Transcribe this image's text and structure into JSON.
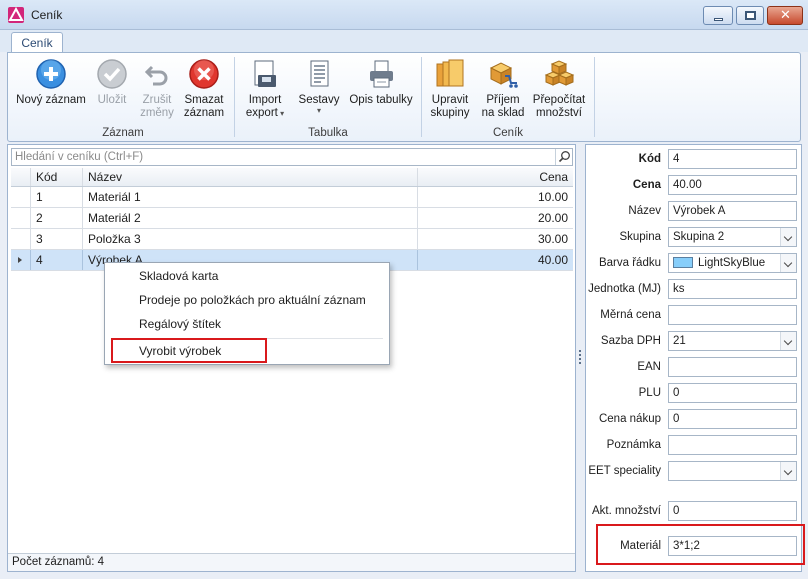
{
  "window": {
    "title": "Ceník"
  },
  "ribbon": {
    "tab": "Ceník",
    "groups": [
      {
        "label": "Záznam"
      },
      {
        "label": "Tabulka"
      },
      {
        "label": "Ceník"
      }
    ],
    "buttons": {
      "new": {
        "line1": "Nový záznam",
        "line2": ""
      },
      "save": {
        "line1": "Uložit",
        "line2": ""
      },
      "cancel": {
        "line1": "Zrušit",
        "line2": "změny"
      },
      "delete": {
        "line1": "Smazat",
        "line2": "záznam"
      },
      "import": {
        "line1": "Import",
        "line2": "export"
      },
      "reports": {
        "line1": "Sestavy",
        "line2": ""
      },
      "copy_table": {
        "line1": "Opis tabulky",
        "line2": ""
      },
      "edit_groups": {
        "line1": "Upravit",
        "line2": "skupiny"
      },
      "receive": {
        "line1": "Příjem",
        "line2": "na sklad"
      },
      "recalc": {
        "line1": "Přepočítat",
        "line2": "množství"
      }
    }
  },
  "search": {
    "placeholder": "Hledání v ceníku (Ctrl+F)"
  },
  "grid": {
    "columns": {
      "kod": "Kód",
      "nazev": "Název",
      "cena": "Cena"
    },
    "rows": [
      {
        "kod": "1",
        "nazev": "Materiál 1",
        "cena": "10.00"
      },
      {
        "kod": "2",
        "nazev": "Materiál 2",
        "cena": "20.00"
      },
      {
        "kod": "3",
        "nazev": "Položka 3",
        "cena": "30.00"
      },
      {
        "kod": "4",
        "nazev": "Výrobek A",
        "cena": "40.00"
      }
    ]
  },
  "status": {
    "text": "Počet záznamů: 4"
  },
  "context_menu": {
    "items": [
      "Skladová karta",
      "Prodeje po položkách pro aktuální záznam",
      "Regálový štítek",
      "Vyrobit výrobek"
    ]
  },
  "detail": {
    "kod": {
      "label": "Kód",
      "value": "4"
    },
    "cena": {
      "label": "Cena",
      "value": "40.00"
    },
    "nazev": {
      "label": "Název",
      "value": "Výrobek A"
    },
    "skupina": {
      "label": "Skupina",
      "value": "Skupina 2"
    },
    "barva": {
      "label": "Barva řádku",
      "value": "LightSkyBlue",
      "color": "#87CEFA"
    },
    "jednotka": {
      "label": "Jednotka (MJ)",
      "value": "ks"
    },
    "merna": {
      "label": "Měrná cena",
      "value": ""
    },
    "dph": {
      "label": "Sazba DPH",
      "value": "21"
    },
    "ean": {
      "label": "EAN",
      "value": ""
    },
    "plu": {
      "label": "PLU",
      "value": "0"
    },
    "nakup": {
      "label": "Cena nákup",
      "value": "0"
    },
    "poznamka": {
      "label": "Poznámka",
      "value": ""
    },
    "eet": {
      "label": "EET speciality",
      "value": ""
    },
    "mnozstvi": {
      "label": "Akt. množství",
      "value": "0"
    },
    "material": {
      "label": "Materiál",
      "value": "3*1;2"
    }
  },
  "colors": {
    "accent": "#d9191c",
    "selection": "#cfe3f8"
  }
}
